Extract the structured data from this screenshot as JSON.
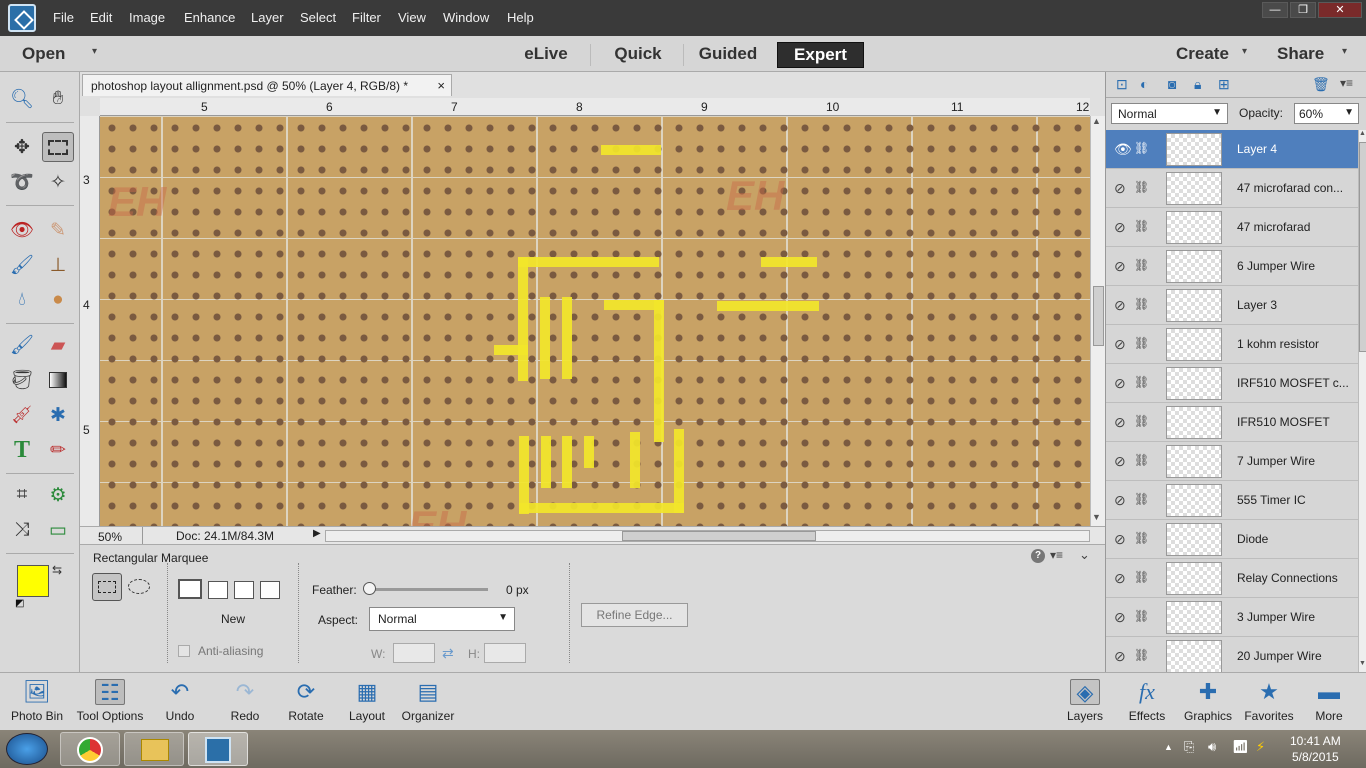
{
  "menubar": {
    "items": [
      "File",
      "Edit",
      "Image",
      "Enhance",
      "Layer",
      "Select",
      "Filter",
      "View",
      "Window",
      "Help"
    ]
  },
  "modebar": {
    "open_label": "Open",
    "modes": [
      "eLive",
      "Quick",
      "Guided",
      "Expert"
    ],
    "active_mode": "Expert",
    "create_label": "Create",
    "share_label": "Share"
  },
  "document": {
    "tab_title": "photoshop layout allignment.psd @ 50% (Layer 4, RGB/8) *",
    "close_glyph": "×",
    "ruler_top": [
      "5",
      "6",
      "7",
      "8",
      "9",
      "10",
      "11",
      "12"
    ],
    "ruler_left": [
      "3",
      "4",
      "5"
    ],
    "zoom": "50%",
    "doc_info": "Doc: 24.1M/84.3M",
    "ghost_text": "EH"
  },
  "tool_options": {
    "tool_name": "Rectangular Marquee",
    "new_label": "New",
    "anti_alias_label": "Anti-aliasing",
    "feather_label": "Feather:",
    "feather_value": "0 px",
    "aspect_label": "Aspect:",
    "aspect_value": "Normal",
    "w_label": "W:",
    "h_label": "H:",
    "refine_edge_label": "Refine Edge...",
    "help_glyph": "?"
  },
  "layers_panel": {
    "blend_mode": "Normal",
    "opacity_label": "Opacity:",
    "opacity_value": "60%",
    "layers": [
      {
        "name": "Layer 4",
        "selected": true,
        "visible": true
      },
      {
        "name": "47 microfarad con...",
        "selected": false,
        "visible": false
      },
      {
        "name": "47 microfarad",
        "selected": false,
        "visible": false
      },
      {
        "name": "6 Jumper Wire",
        "selected": false,
        "visible": false
      },
      {
        "name": "Layer 3",
        "selected": false,
        "visible": false
      },
      {
        "name": "1 kohm resistor",
        "selected": false,
        "visible": false
      },
      {
        "name": "IRF510 MOSFET c...",
        "selected": false,
        "visible": false
      },
      {
        "name": "IFR510 MOSFET",
        "selected": false,
        "visible": false
      },
      {
        "name": "7 Jumper Wire",
        "selected": false,
        "visible": false
      },
      {
        "name": "555 Timer IC",
        "selected": false,
        "visible": false
      },
      {
        "name": "Diode",
        "selected": false,
        "visible": false
      },
      {
        "name": "Relay Connections",
        "selected": false,
        "visible": false
      },
      {
        "name": "3 Jumper Wire",
        "selected": false,
        "visible": false
      },
      {
        "name": "20 Jumper Wire",
        "selected": false,
        "visible": false
      }
    ]
  },
  "bottombar": {
    "left": [
      "Photo Bin",
      "Tool Options",
      "Undo",
      "Redo",
      "Rotate",
      "Layout",
      "Organizer"
    ],
    "right": [
      "Layers",
      "Effects",
      "Graphics",
      "Favorites",
      "More"
    ]
  },
  "taskbar": {
    "time": "10:41 AM",
    "date": "5/8/2015"
  },
  "colors": {
    "foreground": "#ffff00",
    "background": "#ffffff",
    "selected_layer": "#4f7fbd",
    "trace": "#f2e62a"
  }
}
